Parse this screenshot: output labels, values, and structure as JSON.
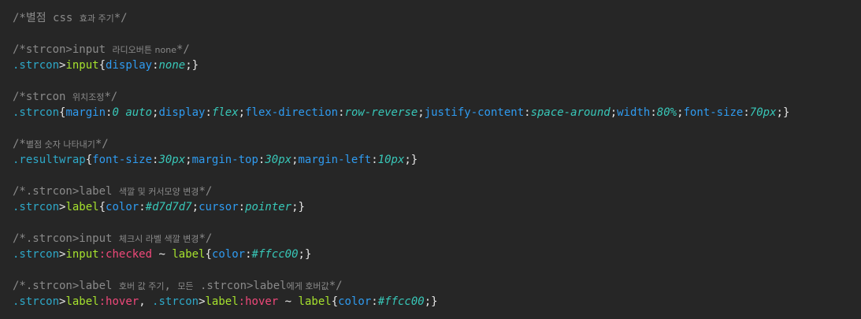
{
  "editor": {
    "lines": [
      [
        [
          "comment",
          "/*별점 css "
        ],
        [
          "comment sm",
          "효과 주기"
        ],
        [
          "comment",
          "*/"
        ]
      ],
      [],
      [
        [
          "comment",
          "/*strcon>input "
        ],
        [
          "comment sm",
          "라디오버튼 none"
        ],
        [
          "comment",
          "*/"
        ]
      ],
      [
        [
          "sel",
          ".strcon"
        ],
        [
          "punct",
          ">"
        ],
        [
          "tag",
          "input"
        ],
        [
          "punct",
          "{"
        ],
        [
          "prop",
          "display"
        ],
        [
          "punct",
          ":"
        ],
        [
          "val",
          "none"
        ],
        [
          "punct",
          ";}"
        ]
      ],
      [],
      [
        [
          "comment",
          "/*strcon "
        ],
        [
          "comment sm",
          "위치조정"
        ],
        [
          "comment",
          "*/"
        ]
      ],
      [
        [
          "sel",
          ".strcon"
        ],
        [
          "punct",
          "{"
        ],
        [
          "prop",
          "margin"
        ],
        [
          "punct",
          ":"
        ],
        [
          "val",
          "0 auto"
        ],
        [
          "punct",
          ";"
        ],
        [
          "prop",
          "display"
        ],
        [
          "punct",
          ":"
        ],
        [
          "val",
          "flex"
        ],
        [
          "punct",
          ";"
        ],
        [
          "prop",
          "flex-direction"
        ],
        [
          "punct",
          ":"
        ],
        [
          "val",
          "row-reverse"
        ],
        [
          "punct",
          ";"
        ],
        [
          "prop",
          "justify-content"
        ],
        [
          "punct",
          ":"
        ],
        [
          "val",
          "space-around"
        ],
        [
          "punct",
          ";"
        ],
        [
          "prop",
          "width"
        ],
        [
          "punct",
          ":"
        ],
        [
          "val",
          "80%"
        ],
        [
          "punct",
          ";"
        ],
        [
          "prop",
          "font-size"
        ],
        [
          "punct",
          ":"
        ],
        [
          "val",
          "70px"
        ],
        [
          "punct",
          ";}"
        ]
      ],
      [],
      [
        [
          "comment",
          "/*"
        ],
        [
          "comment sm",
          "별점 숫자 나타내기"
        ],
        [
          "comment",
          "*/"
        ]
      ],
      [
        [
          "sel",
          ".resultwrap"
        ],
        [
          "punct",
          "{"
        ],
        [
          "prop",
          "font-size"
        ],
        [
          "punct",
          ":"
        ],
        [
          "val",
          "30px"
        ],
        [
          "punct",
          ";"
        ],
        [
          "prop",
          "margin-top"
        ],
        [
          "punct",
          ":"
        ],
        [
          "val",
          "30px"
        ],
        [
          "punct",
          ";"
        ],
        [
          "prop",
          "margin-left"
        ],
        [
          "punct",
          ":"
        ],
        [
          "val",
          "10px"
        ],
        [
          "punct",
          ";}"
        ]
      ],
      [],
      [
        [
          "comment",
          "/*.strcon>label "
        ],
        [
          "comment sm",
          "색깔 및 커서모양 변경"
        ],
        [
          "comment",
          "*/"
        ]
      ],
      [
        [
          "sel",
          ".strcon"
        ],
        [
          "punct",
          ">"
        ],
        [
          "tag",
          "label"
        ],
        [
          "punct",
          "{"
        ],
        [
          "prop",
          "color"
        ],
        [
          "punct",
          ":"
        ],
        [
          "val",
          "#d7d7d7"
        ],
        [
          "punct",
          ";"
        ],
        [
          "prop",
          "cursor"
        ],
        [
          "punct",
          ":"
        ],
        [
          "val",
          "pointer"
        ],
        [
          "punct",
          ";}"
        ]
      ],
      [],
      [
        [
          "comment",
          "/*.strcon>input "
        ],
        [
          "comment sm",
          "체크시 라벨 색깔 변경"
        ],
        [
          "comment",
          "*/"
        ]
      ],
      [
        [
          "sel",
          ".strcon"
        ],
        [
          "punct",
          ">"
        ],
        [
          "tag",
          "input"
        ],
        [
          "pseudo",
          ":checked"
        ],
        [
          "punct",
          " ~ "
        ],
        [
          "tag",
          "label"
        ],
        [
          "punct",
          "{"
        ],
        [
          "prop",
          "color"
        ],
        [
          "punct",
          ":"
        ],
        [
          "val",
          "#ffcc00"
        ],
        [
          "punct",
          ";}"
        ]
      ],
      [],
      [
        [
          "comment",
          "/*.strcon>label "
        ],
        [
          "comment sm",
          "호버 값 주기"
        ],
        [
          "comment",
          ", "
        ],
        [
          "comment sm",
          "모든"
        ],
        [
          "comment",
          " .strcon>label"
        ],
        [
          "comment sm",
          "에게 호버값"
        ],
        [
          "comment",
          "*/"
        ]
      ],
      [
        [
          "sel",
          ".strcon"
        ],
        [
          "punct",
          ">"
        ],
        [
          "tag",
          "label"
        ],
        [
          "pseudo",
          ":hover"
        ],
        [
          "punct",
          ", "
        ],
        [
          "sel",
          ".strcon"
        ],
        [
          "punct",
          ">"
        ],
        [
          "tag",
          "label"
        ],
        [
          "pseudo",
          ":hover"
        ],
        [
          "punct",
          " ~ "
        ],
        [
          "tag",
          "label"
        ],
        [
          "punct",
          "{"
        ],
        [
          "prop",
          "color"
        ],
        [
          "punct",
          ":"
        ],
        [
          "val",
          "#ffcc00"
        ],
        [
          "punct",
          ";}"
        ]
      ]
    ]
  }
}
